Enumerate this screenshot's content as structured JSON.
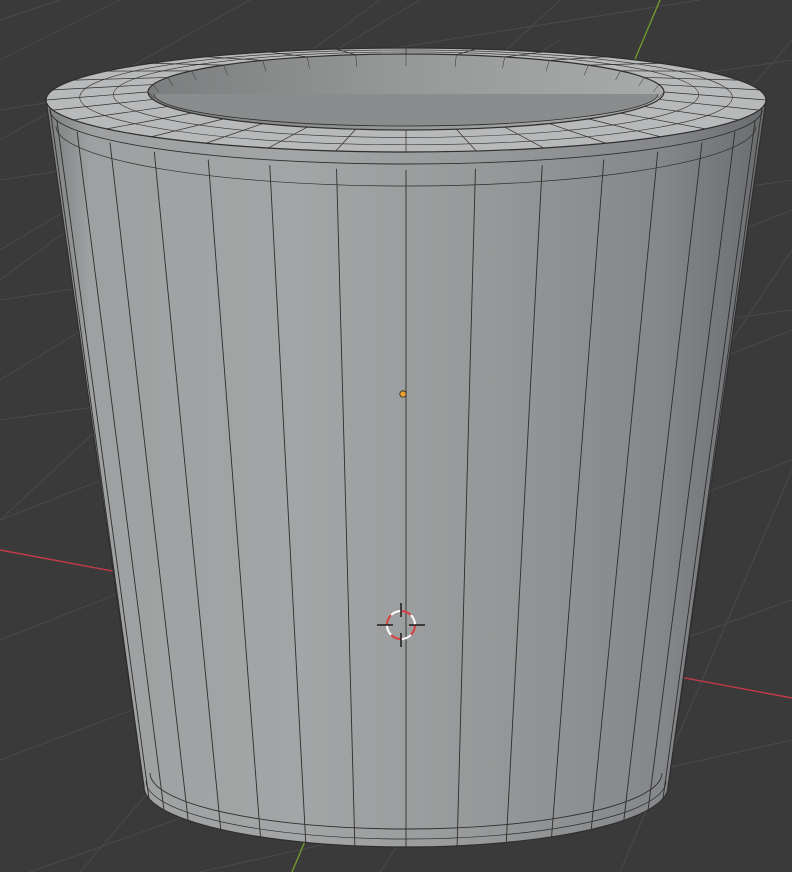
{
  "viewport": {
    "background": "#3a3a3a",
    "grid_color": "#4a4a4a",
    "x_axis_color": "#c43a48",
    "y_axis_color": "#6e9a2c"
  },
  "mesh": {
    "object": "cylinder-tube",
    "side_segments": 32,
    "wire_color": "#2e2e2e",
    "outer_body_color": "#9c9e9f",
    "inner_wall_color": "#8d8f90",
    "top_face_color": "#b8b9ba"
  },
  "origin_point": {
    "color": "#f0a030"
  },
  "cursor_3d": {
    "ring_primary": "#d94040",
    "ring_secondary": "#ffffff",
    "crosshair": "#111111"
  }
}
